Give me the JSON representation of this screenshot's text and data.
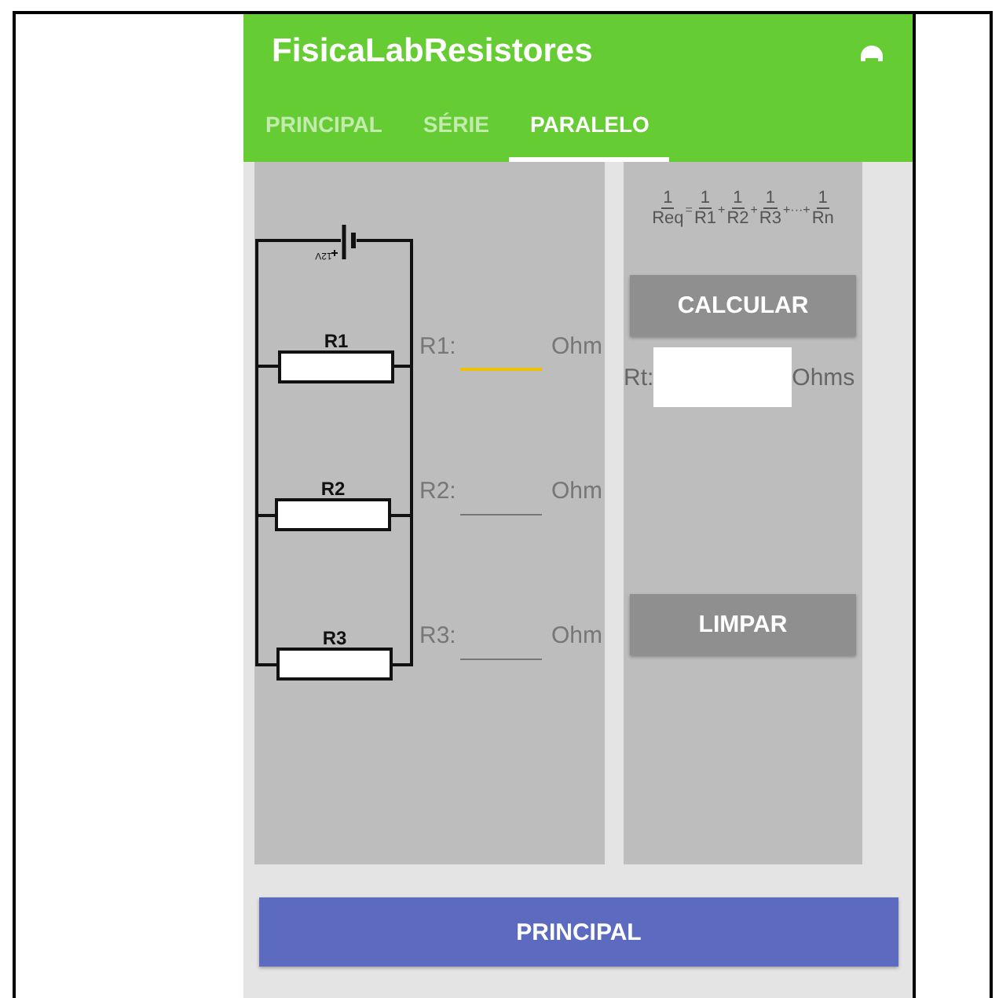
{
  "app_bar": {
    "title": "FisicaLabResistores"
  },
  "tabs": [
    {
      "label": "PRINCIPAL",
      "selected": false
    },
    {
      "label": "SÉRIE",
      "selected": false
    },
    {
      "label": "PARALELO",
      "selected": true
    }
  ],
  "circuit": {
    "battery_label": "12V",
    "resistor_labels": [
      "R1",
      "R2",
      "R3"
    ]
  },
  "resistor_inputs": [
    {
      "label": "R1:",
      "unit": "Ohm",
      "focused": true
    },
    {
      "label": "R2:",
      "unit": "Ohm",
      "focused": false
    },
    {
      "label": "R3:",
      "unit": "Ohm",
      "focused": false
    }
  ],
  "formula": [
    {
      "kind": "fraction",
      "numerator": "1",
      "denominator": "Req"
    },
    {
      "kind": "operator",
      "text": "="
    },
    {
      "kind": "fraction",
      "numerator": "1",
      "denominator": "R1"
    },
    {
      "kind": "operator",
      "text": "+"
    },
    {
      "kind": "fraction",
      "numerator": "1",
      "denominator": "R2"
    },
    {
      "kind": "operator",
      "text": "+"
    },
    {
      "kind": "fraction",
      "numerator": "1",
      "denominator": "R3"
    },
    {
      "kind": "operator",
      "text": "+···+"
    },
    {
      "kind": "fraction",
      "numerator": "1",
      "denominator": "Rn"
    }
  ],
  "calculate_button": "CALCULAR",
  "result": {
    "label": "Rt:",
    "unit": "Ohms"
  },
  "clear_button": "LIMPAR",
  "bottom_button": "PRINCIPAL"
}
